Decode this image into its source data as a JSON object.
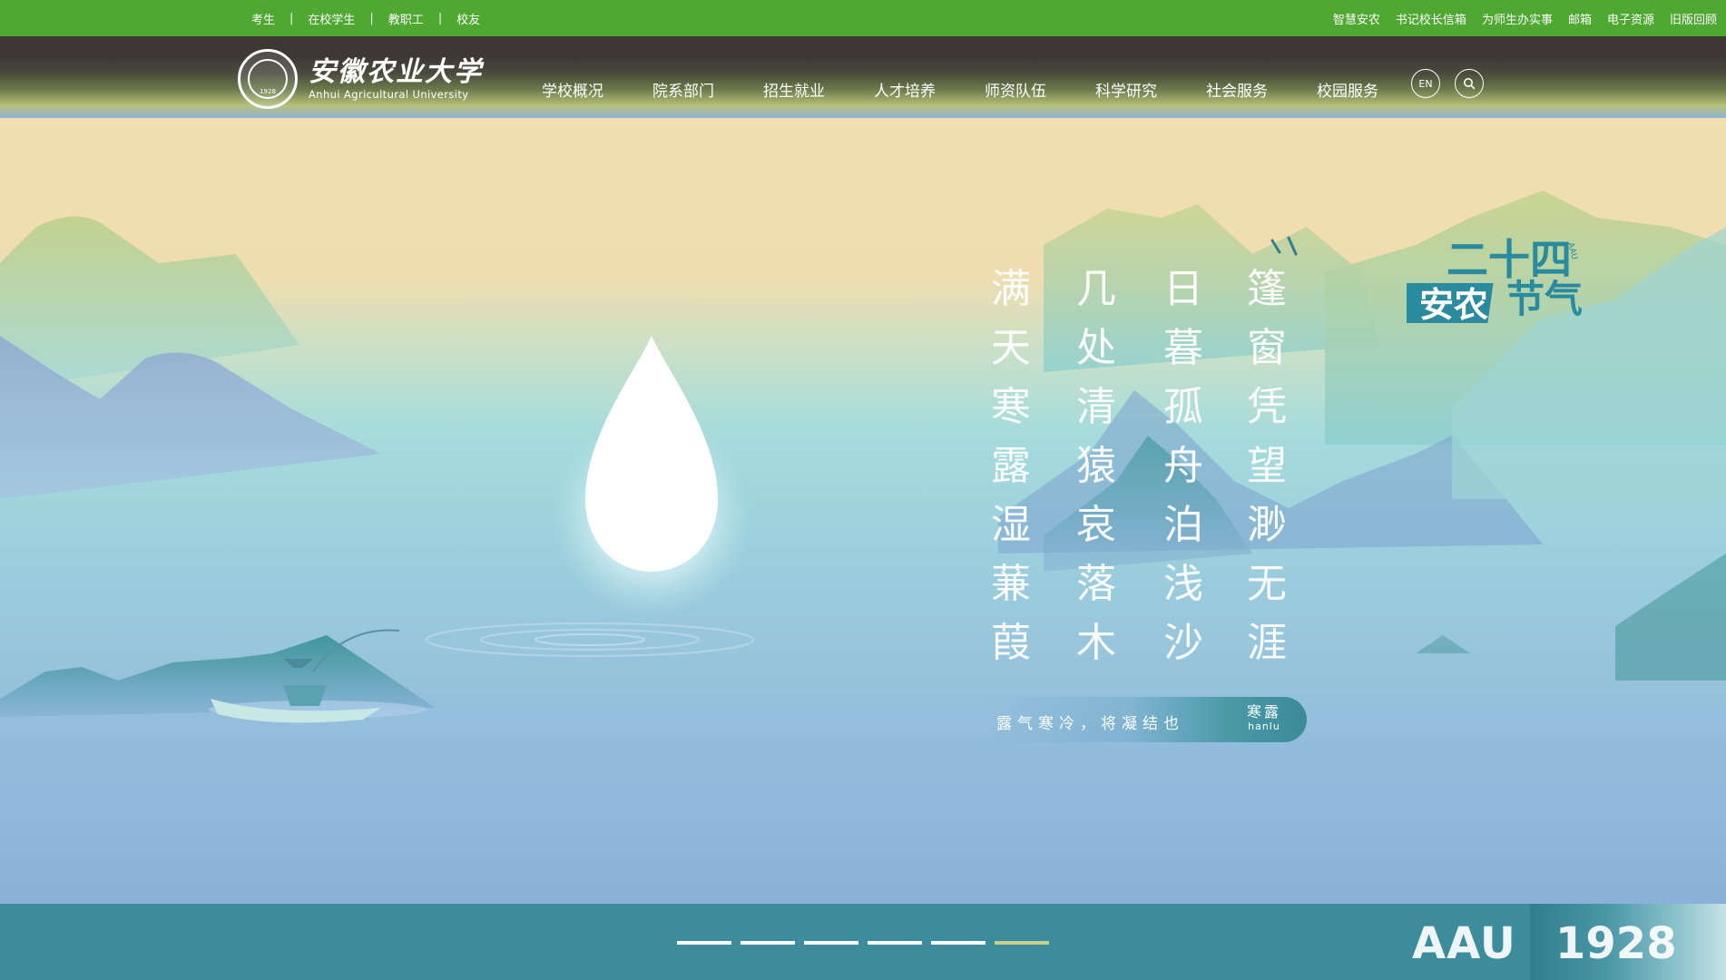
{
  "topbar": {
    "left_links": [
      "考生",
      "在校学生",
      "教职工",
      "校友"
    ],
    "separator": "|",
    "right_links": [
      "智慧安农",
      "书记校长信箱",
      "为师生办实事",
      "邮箱",
      "电子资源",
      "旧版回顾"
    ]
  },
  "logo": {
    "cn": "安徽农业大学",
    "en": "Anhui Agricultural University",
    "seal_year": "1928"
  },
  "nav": {
    "items": [
      "学校概况",
      "院系部门",
      "招生就业",
      "人才培养",
      "师资队伍",
      "科学研究",
      "社会服务",
      "校园服务"
    ],
    "lang_button": "EN",
    "search_icon": "search-icon"
  },
  "badge": {
    "line1": "二十四",
    "line2": "安农",
    "line3": "节气",
    "tag": "AAU"
  },
  "poem": {
    "columns": [
      [
        "篷",
        "窗",
        "凭",
        "望",
        "渺",
        "无",
        "涯"
      ],
      [
        "日",
        "暮",
        "孤",
        "舟",
        "泊",
        "浅",
        "沙"
      ],
      [
        "几",
        "处",
        "清",
        "猿",
        "哀",
        "落",
        "木"
      ],
      [
        "满",
        "天",
        "寒",
        "露",
        "湿",
        "蒹",
        "葭"
      ]
    ]
  },
  "caption": {
    "text": "露气寒冷，将凝结也",
    "term_cn": "寒露",
    "term_py": "hanlu"
  },
  "carousel": {
    "count": 6,
    "active_index": 5
  },
  "footer": {
    "abbr": "AAU",
    "year": "1928"
  },
  "colors": {
    "topbar": "#4ea832",
    "nav": "#3e3738",
    "bottom": "#3d8c9c",
    "badge": "#2a8a9e"
  }
}
